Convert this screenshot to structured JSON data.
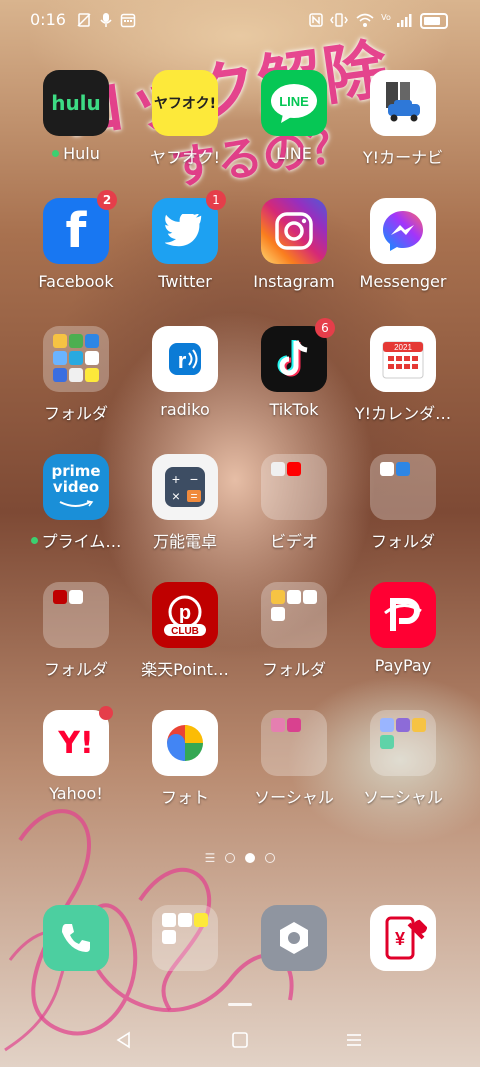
{
  "status_bar": {
    "time": "0:16",
    "left_icons": [
      "no-sim-icon",
      "mic-icon",
      "calendar-icon"
    ],
    "right_icons": [
      "nfc-icon",
      "vibrate-icon",
      "wifi-icon",
      "signal-icon",
      "battery-icon"
    ],
    "volte_label": "Vo"
  },
  "wallpaper": {
    "overlay_line1": "ロック解除",
    "overlay_line2": "するの？"
  },
  "apps": [
    {
      "id": "hulu",
      "label": "Hulu",
      "icon_text": "hulu",
      "new": true
    },
    {
      "id": "yafuoku",
      "label": "ヤフオク!",
      "icon_text": "ヤフオク!"
    },
    {
      "id": "line",
      "label": "LINE",
      "icon_text": "LINE"
    },
    {
      "id": "carnavi",
      "label": "Y!カーナビ"
    },
    {
      "id": "facebook",
      "label": "Facebook",
      "icon_text": "f",
      "badge": "2"
    },
    {
      "id": "twitter",
      "label": "Twitter",
      "badge": "1"
    },
    {
      "id": "instagram",
      "label": "Instagram"
    },
    {
      "id": "messenger",
      "label": "Messenger"
    },
    {
      "id": "folder1",
      "label": "フォルダ"
    },
    {
      "id": "radiko",
      "label": "radiko"
    },
    {
      "id": "tiktok",
      "label": "TikTok",
      "badge": "6"
    },
    {
      "id": "calendar",
      "label": "Y!カレンダ…",
      "icon_text": "2021"
    },
    {
      "id": "prime",
      "label": "プライム…",
      "icon_text_1": "prime",
      "icon_text_2": "video",
      "new": true
    },
    {
      "id": "calc",
      "label": "万能電卓"
    },
    {
      "id": "video",
      "label": "ビデオ"
    },
    {
      "id": "folder2",
      "label": "フォルダ"
    },
    {
      "id": "folder3",
      "label": "フォルダ"
    },
    {
      "id": "rakuten",
      "label": "楽天Point…",
      "icon_text": "CLUB"
    },
    {
      "id": "folder4",
      "label": "フォルダ"
    },
    {
      "id": "paypay",
      "label": "PayPay"
    },
    {
      "id": "yahoo",
      "label": "Yahoo!",
      "icon_text": "Y!"
    },
    {
      "id": "photos",
      "label": "フォト"
    },
    {
      "id": "social1",
      "label": "ソーシャル"
    },
    {
      "id": "social2",
      "label": "ソーシャル"
    }
  ],
  "dock": [
    {
      "id": "phone"
    },
    {
      "id": "dock-folder"
    },
    {
      "id": "settings"
    },
    {
      "id": "repair"
    }
  ],
  "pager": {
    "pages": 3,
    "current": 2
  },
  "colors": {
    "badge": "#e53e4a",
    "new_dot": "#3cd070",
    "overlay_pink": "#e8338f"
  }
}
